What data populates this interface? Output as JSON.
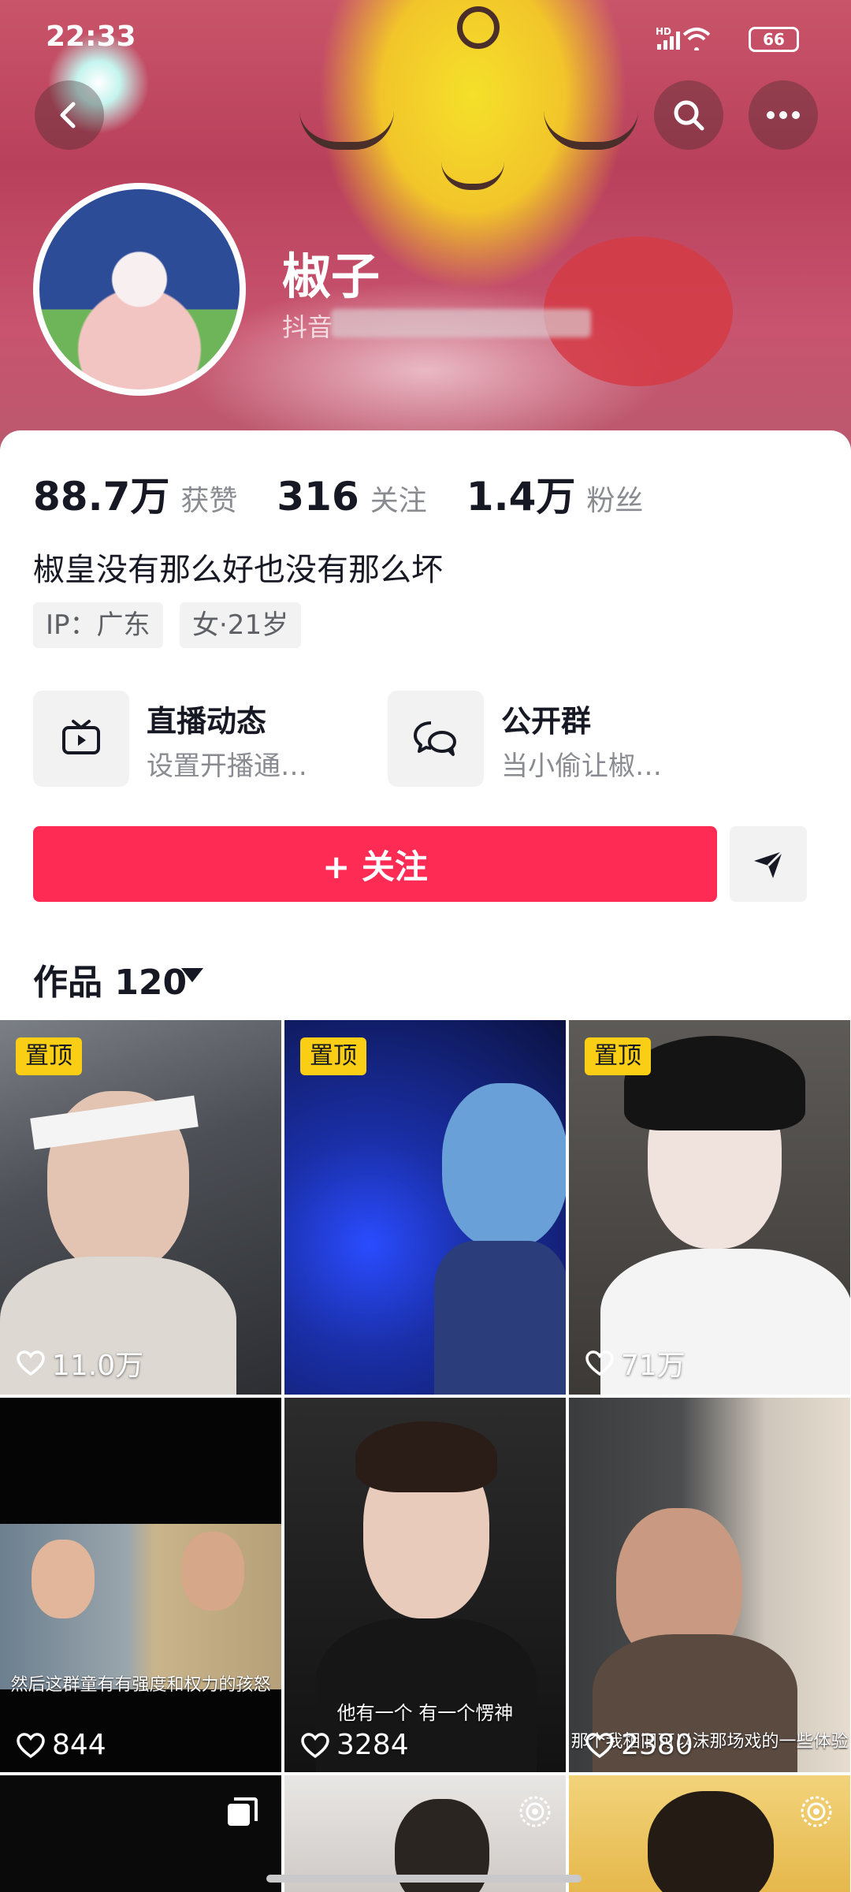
{
  "status_bar": {
    "time": "22:33",
    "network": "HD",
    "battery": "66"
  },
  "profile": {
    "nickname": "椒子",
    "id_prefix": "抖音",
    "bio": "椒皇没有那么好也没有那么坏",
    "tags": [
      "IP：广东",
      "女·21岁"
    ]
  },
  "stats": [
    {
      "value": "88.7万",
      "label": "获赞"
    },
    {
      "value": "316",
      "label": "关注"
    },
    {
      "value": "1.4万",
      "label": "粉丝"
    }
  ],
  "features": [
    {
      "title": "直播动态",
      "subtitle": "设置开播通…",
      "icon": "tv-icon"
    },
    {
      "title": "公开群",
      "subtitle": "当小偷让椒…",
      "icon": "chat-bubbles-icon"
    }
  ],
  "follow_button": "+ 关注",
  "works": {
    "label": "作品 120"
  },
  "videos": [
    {
      "pinned": "置顶",
      "likes": "11.0万"
    },
    {
      "pinned": "置顶",
      "likes": ""
    },
    {
      "pinned": "置顶",
      "likes": "71万"
    },
    {
      "pinned": "",
      "likes": "844",
      "caption": "然后这群童有有强度和权力的孩怒"
    },
    {
      "pinned": "",
      "likes": "3284",
      "caption": "他有一个 有一个愣神"
    },
    {
      "pinned": "",
      "likes": "2380",
      "caption": "那个我相旧可以沫那场戏的一些体验"
    },
    {
      "pinned": "",
      "likes": ""
    },
    {
      "pinned": "",
      "likes": ""
    },
    {
      "pinned": "",
      "likes": ""
    }
  ],
  "colors": {
    "accent": "#fe2c55",
    "pin": "#face15"
  }
}
